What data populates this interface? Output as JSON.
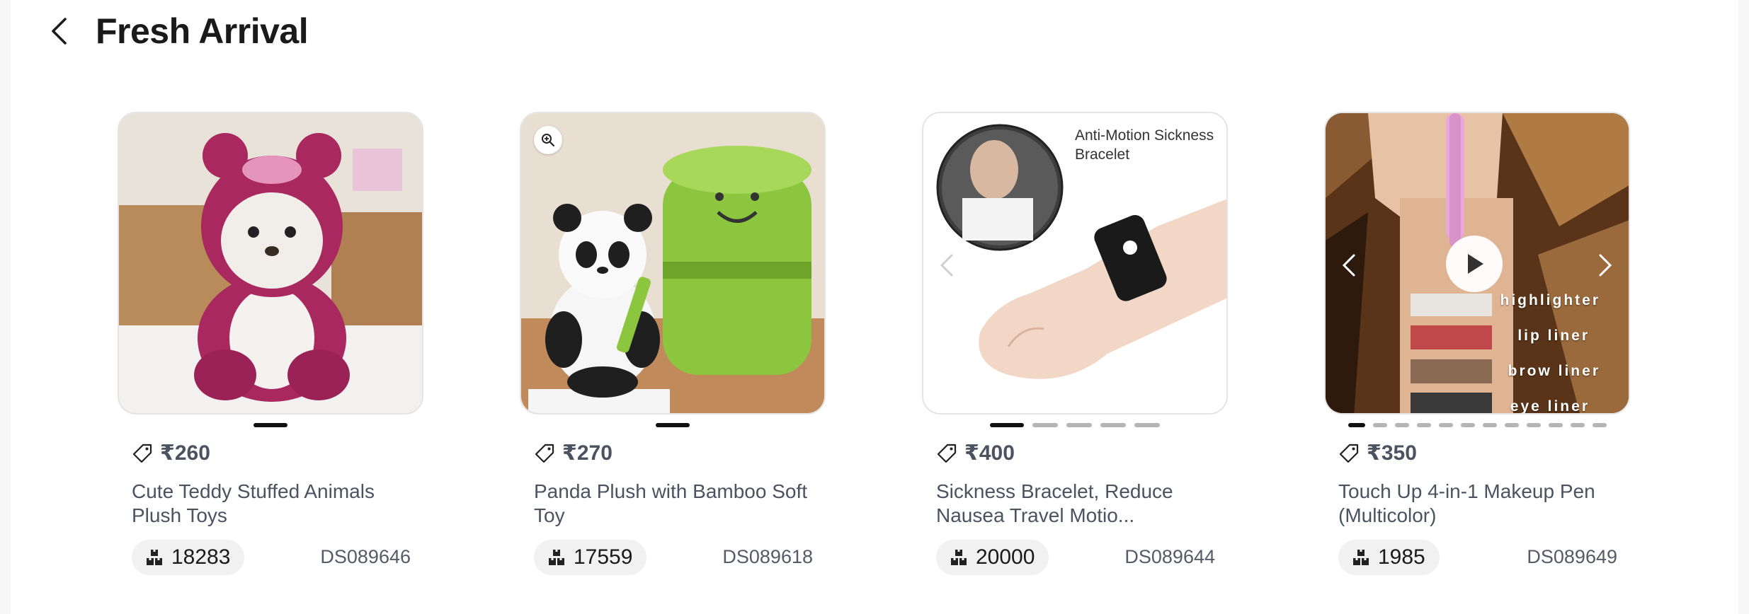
{
  "header": {
    "title": "Fresh Arrival"
  },
  "products": [
    {
      "price": "₹260",
      "name": "Cute Teddy Stuffed Animals Plush Toys",
      "stock": "18283",
      "sku": "DS089646",
      "slides": 1,
      "active_slide": 0
    },
    {
      "price": "₹270",
      "name": "Panda Plush with Bamboo Soft Toy",
      "stock": "17559",
      "sku": "DS089618",
      "slides": 1,
      "active_slide": 0
    },
    {
      "price": "₹400",
      "name": "Sickness Bracelet, Reduce Nausea Travel Motio...",
      "stock": "20000",
      "sku": "DS089644",
      "slides": 5,
      "active_slide": 0,
      "image_text": "Anti-Motion Sickness Bracelet"
    },
    {
      "price": "₹350",
      "name": "Touch Up 4-in-1 Makeup Pen (Multicolor)",
      "stock": "1985",
      "sku": "DS089649",
      "slides": 12,
      "active_slide": 0,
      "image_labels": [
        "highlighter",
        "lip liner",
        "brow liner",
        "eye liner"
      ]
    }
  ],
  "icons": {
    "back": "chevron-left-icon",
    "price": "price-tag-icon",
    "stock": "boxes-icon",
    "zoom": "zoom-in-icon",
    "play": "play-icon"
  },
  "colors": {
    "active_dot": "#111111",
    "inactive_dot": "#b5b5b5",
    "text": "#4b5260",
    "pill_bg": "#f1f1f1"
  }
}
